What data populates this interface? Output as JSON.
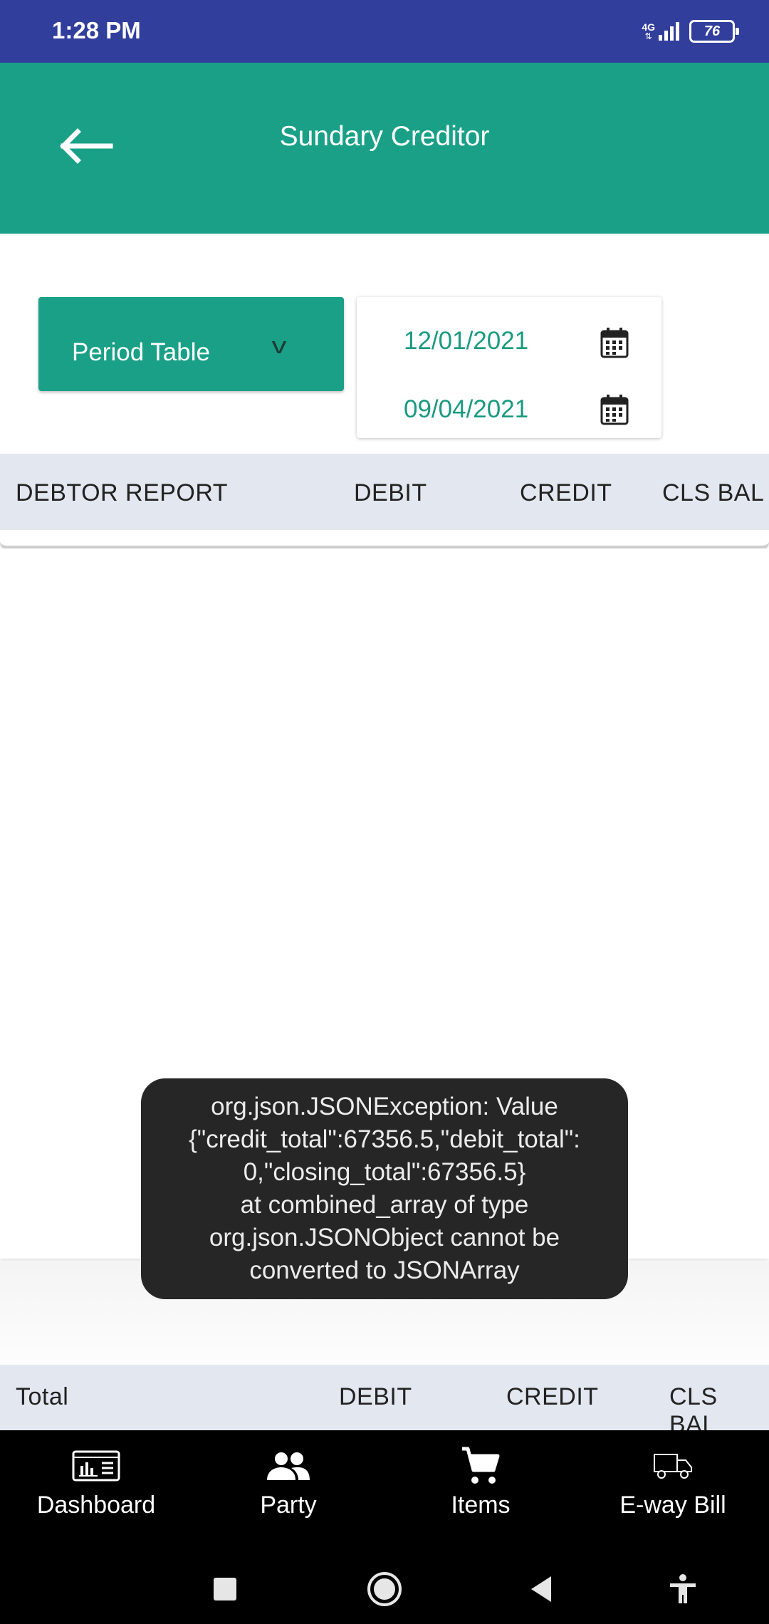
{
  "status_bar": {
    "time": "1:28 PM",
    "network": "4G",
    "battery": "76"
  },
  "app_bar": {
    "title": "Sundary Creditor"
  },
  "filters": {
    "period_label": "Period Table",
    "from_date": "12/01/2021",
    "to_date": "09/04/2021"
  },
  "table_header": {
    "col_report": "DEBTOR REPORT",
    "col_debit": "DEBIT",
    "col_credit": "CREDIT",
    "col_cls_bal": "CLS BAL"
  },
  "total_row": {
    "label": "Total",
    "debit": "DEBIT",
    "credit": "CREDIT",
    "cls_bal": "CLS BAL"
  },
  "toast": {
    "lines": [
      "org.json.JSONException: Value",
      "{\"credit_total\":67356.5,\"debit_total\":",
      "0,\"closing_total\":67356.5}",
      "at combined_array of type",
      "org.json.JSONObject cannot be",
      "converted to JSONArray"
    ]
  },
  "bottom_nav": {
    "items": [
      {
        "label": "Dashboard",
        "icon": "dashboard-icon"
      },
      {
        "label": "Party",
        "icon": "people-icon"
      },
      {
        "label": "Items",
        "icon": "cart-icon"
      },
      {
        "label": "E-way Bill",
        "icon": "truck-icon"
      }
    ]
  },
  "system_nav": [
    "recents-button",
    "home-button",
    "back-button",
    "accessibility-button"
  ]
}
